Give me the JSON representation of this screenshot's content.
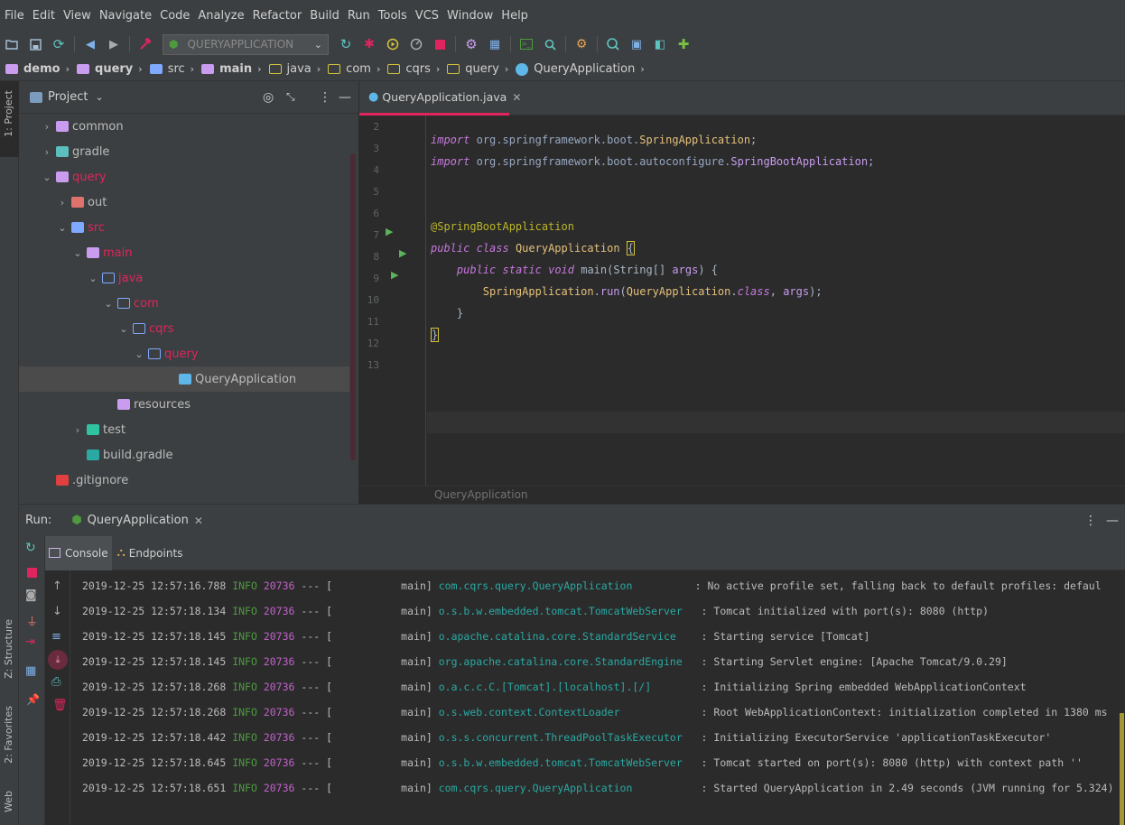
{
  "menu": [
    "File",
    "Edit",
    "View",
    "Navigate",
    "Code",
    "Analyze",
    "Refactor",
    "Build",
    "Run",
    "Tools",
    "VCS",
    "Window",
    "Help"
  ],
  "toolbar": {
    "run_config": "QUERYAPPLICATION"
  },
  "breadcrumb": [
    "demo",
    "query",
    "src",
    "main",
    "java",
    "com",
    "cqrs",
    "query",
    "QueryApplication"
  ],
  "left_strip": {
    "project_tab": "1: Project",
    "structure_tab": "Z: Structure",
    "favorites_tab": "2: Favorites",
    "web_tab": "Web"
  },
  "project": {
    "title": "Project",
    "tree": [
      {
        "label": "common",
        "indent": 1,
        "arrow": "›",
        "color": "#c99cf0",
        "selected": false,
        "text_color": "#bbbbbb"
      },
      {
        "label": "gradle",
        "indent": 1,
        "arrow": "›",
        "color": "#5bbfbe",
        "selected": false,
        "text_color": "#bbbbbb"
      },
      {
        "label": "query",
        "indent": 1,
        "arrow": "⌄",
        "color": "#c99cf0",
        "selected": false,
        "text_color": "#e0245e"
      },
      {
        "label": "out",
        "indent": 2,
        "arrow": "›",
        "color": "#e0726e",
        "selected": false,
        "text_color": "#bbbbbb"
      },
      {
        "label": "src",
        "indent": 2,
        "arrow": "⌄",
        "color": "#7fa8ff",
        "selected": false,
        "text_color": "#e0245e"
      },
      {
        "label": "main",
        "indent": 3,
        "arrow": "⌄",
        "color": "#c99cf0",
        "selected": false,
        "text_color": "#e0245e"
      },
      {
        "label": "java",
        "indent": 4,
        "arrow": "⌄",
        "color": "#7fa8ff",
        "selected": false,
        "text_color": "#e0245e"
      },
      {
        "label": "com",
        "indent": 5,
        "arrow": "⌄",
        "color": "#7fa8ff",
        "selected": false,
        "text_color": "#e0245e"
      },
      {
        "label": "cqrs",
        "indent": 6,
        "arrow": "⌄",
        "color": "#7fa8ff",
        "selected": false,
        "text_color": "#e0245e"
      },
      {
        "label": "query",
        "indent": 7,
        "arrow": "⌄",
        "color": "#7fa8ff",
        "selected": false,
        "text_color": "#e0245e"
      },
      {
        "label": "QueryApplication",
        "indent": 9,
        "arrow": "",
        "color": "#5eb7e8",
        "selected": true,
        "text_color": "#bbbbbb"
      },
      {
        "label": "resources",
        "indent": 5,
        "arrow": "",
        "color": "#c99cf0",
        "selected": false,
        "text_color": "#bbbbbb"
      },
      {
        "label": "test",
        "indent": 3,
        "arrow": "›",
        "color": "#2ec4a0",
        "selected": false,
        "text_color": "#bbbbbb"
      },
      {
        "label": "build.gradle",
        "indent": 3,
        "arrow": "",
        "color": "#2aa9a3",
        "selected": false,
        "text_color": "#bbbbbb"
      },
      {
        "label": ".gitignore",
        "indent": 1,
        "arrow": "",
        "color": "#e04040",
        "selected": false,
        "text_color": "#bbbbbb"
      }
    ]
  },
  "editor": {
    "tab_label": "QueryApplication.java",
    "footer_crumb": "QueryApplication",
    "line_numbers": [
      "2",
      "3",
      "4",
      "5",
      "6",
      "7",
      "8",
      "9",
      "10",
      "11",
      "12",
      "13"
    ]
  },
  "run": {
    "label": "Run:",
    "tab_label": "QueryApplication",
    "console_tab": "Console",
    "endpoints_tab": "Endpoints",
    "logs": [
      {
        "ts": "2019-12-25 12:57:16.788",
        "lvl": "INFO",
        "pid": "20736",
        "sep": "--- [           main]",
        "logger": "com.cqrs.query.QueryApplication         ",
        "msg": ": No active profile set, falling back to default profiles: defaul"
      },
      {
        "ts": "2019-12-25 12:57:18.134",
        "lvl": "INFO",
        "pid": "20736",
        "sep": "--- [           main]",
        "logger": "o.s.b.w.embedded.tomcat.TomcatWebServer  ",
        "msg": ": Tomcat initialized with port(s): 8080 (http)"
      },
      {
        "ts": "2019-12-25 12:57:18.145",
        "lvl": "INFO",
        "pid": "20736",
        "sep": "--- [           main]",
        "logger": "o.apache.catalina.core.StandardService   ",
        "msg": ": Starting service [Tomcat]"
      },
      {
        "ts": "2019-12-25 12:57:18.145",
        "lvl": "INFO",
        "pid": "20736",
        "sep": "--- [           main]",
        "logger": "org.apache.catalina.core.StandardEngine  ",
        "msg": ": Starting Servlet engine: [Apache Tomcat/9.0.29]"
      },
      {
        "ts": "2019-12-25 12:57:18.268",
        "lvl": "INFO",
        "pid": "20736",
        "sep": "--- [           main]",
        "logger": "o.a.c.c.C.[Tomcat].[localhost].[/]       ",
        "msg": ": Initializing Spring embedded WebApplicationContext"
      },
      {
        "ts": "2019-12-25 12:57:18.268",
        "lvl": "INFO",
        "pid": "20736",
        "sep": "--- [           main]",
        "logger": "o.s.web.context.ContextLoader            ",
        "msg": ": Root WebApplicationContext: initialization completed in 1380 ms"
      },
      {
        "ts": "2019-12-25 12:57:18.442",
        "lvl": "INFO",
        "pid": "20736",
        "sep": "--- [           main]",
        "logger": "o.s.s.concurrent.ThreadPoolTaskExecutor  ",
        "msg": ": Initializing ExecutorService 'applicationTaskExecutor'"
      },
      {
        "ts": "2019-12-25 12:57:18.645",
        "lvl": "INFO",
        "pid": "20736",
        "sep": "--- [           main]",
        "logger": "o.s.b.w.embedded.tomcat.TomcatWebServer  ",
        "msg": ": Tomcat started on port(s): 8080 (http) with context path ''"
      },
      {
        "ts": "2019-12-25 12:57:18.651",
        "lvl": "INFO",
        "pid": "20736",
        "sep": "--- [           main]",
        "logger": "com.cqrs.query.QueryApplication          ",
        "msg": ": Started QueryApplication in 2.49 seconds (JVM running for 5.324)"
      }
    ]
  },
  "icons": [
    "folder-open-icon",
    "save-icon",
    "sync-icon",
    "back-icon",
    "forward-icon",
    "hammer-icon",
    "rerun-icon",
    "debug-icon",
    "coverage-icon",
    "profile-icon",
    "stop-icon",
    "settings-icon",
    "structure-icon",
    "terminal-icon",
    "search-icon",
    "plugin-icon"
  ]
}
